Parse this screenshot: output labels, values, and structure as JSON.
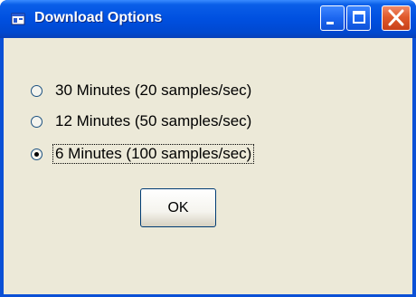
{
  "window": {
    "title": "Download Options",
    "icons": {
      "app": "window-app-icon",
      "minimize": "minimize-icon",
      "maximize": "maximize-icon",
      "close": "close-icon"
    }
  },
  "options": [
    {
      "label": "30 Minutes (20 samples/sec)",
      "selected": false
    },
    {
      "label": "12 Minutes (50 samples/sec)",
      "selected": false
    },
    {
      "label": "6 Minutes (100 samples/sec)",
      "selected": true
    }
  ],
  "ok_label": "OK",
  "colors": {
    "titlebar": "#0050e0",
    "client_background": "#ece9d8",
    "close_button": "#e05a2c"
  }
}
